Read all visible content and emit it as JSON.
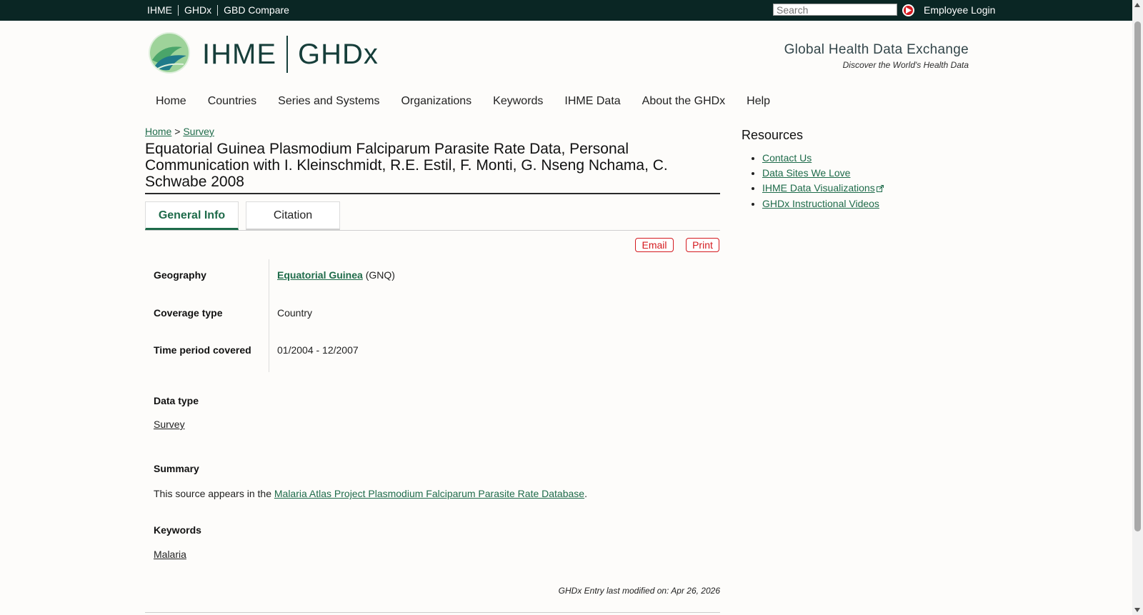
{
  "topbar": {
    "links": [
      "IHME",
      "GHDx",
      "GBD Compare"
    ],
    "search_placeholder": "Search",
    "employee_login": "Employee Login"
  },
  "header": {
    "logo_ihme": "IHME",
    "logo_ghdx": "GHDx",
    "tagline_title": "Global Health Data Exchange",
    "tagline_sub": "Discover the World's Health Data"
  },
  "nav": {
    "items": [
      "Home",
      "Countries",
      "Series and Systems",
      "Organizations",
      "Keywords",
      "IHME Data",
      "About the GHDx",
      "Help"
    ]
  },
  "breadcrumb": {
    "home": "Home",
    "sep": ">",
    "survey": "Survey"
  },
  "page_title": "Equatorial Guinea Plasmodium Falciparum Parasite Rate Data, Personal Communication with I. Kleinschmidt, R.E. Estil, F. Monti, G. Nseng Nchama, C. Schwabe 2008",
  "tabs": {
    "general": "General Info",
    "citation": "Citation"
  },
  "actions": {
    "email": "Email",
    "print": "Print"
  },
  "info": {
    "geography_label": "Geography",
    "geography_link": "Equatorial Guinea",
    "geography_code": "(GNQ)",
    "coverage_label": "Coverage type",
    "coverage_value": "Country",
    "time_label": "Time period covered",
    "time_value": "01/2004 - 12/2007"
  },
  "data_type": {
    "label": "Data type",
    "value": "Survey"
  },
  "summary": {
    "label": "Summary",
    "prefix": "This source appears in the ",
    "link": "Malaria Atlas Project Plasmodium Falciparum Parasite Rate Database",
    "suffix": "."
  },
  "keywords": {
    "label": "Keywords",
    "value": "Malaria"
  },
  "modified": "GHDx Entry last modified on: Apr 26, 2026",
  "resources": {
    "title": "Resources",
    "items": [
      "Contact Us",
      "Data Sites We Love",
      "IHME Data Visualizations",
      "GHDx Instructional Videos"
    ]
  },
  "colors": {
    "topbar": "#0a2624",
    "link": "#1e6b4a",
    "accent_red": "#d41a1f"
  },
  "icons": [
    "search-go-icon",
    "ihme-logo-icon",
    "external-link-icon"
  ]
}
